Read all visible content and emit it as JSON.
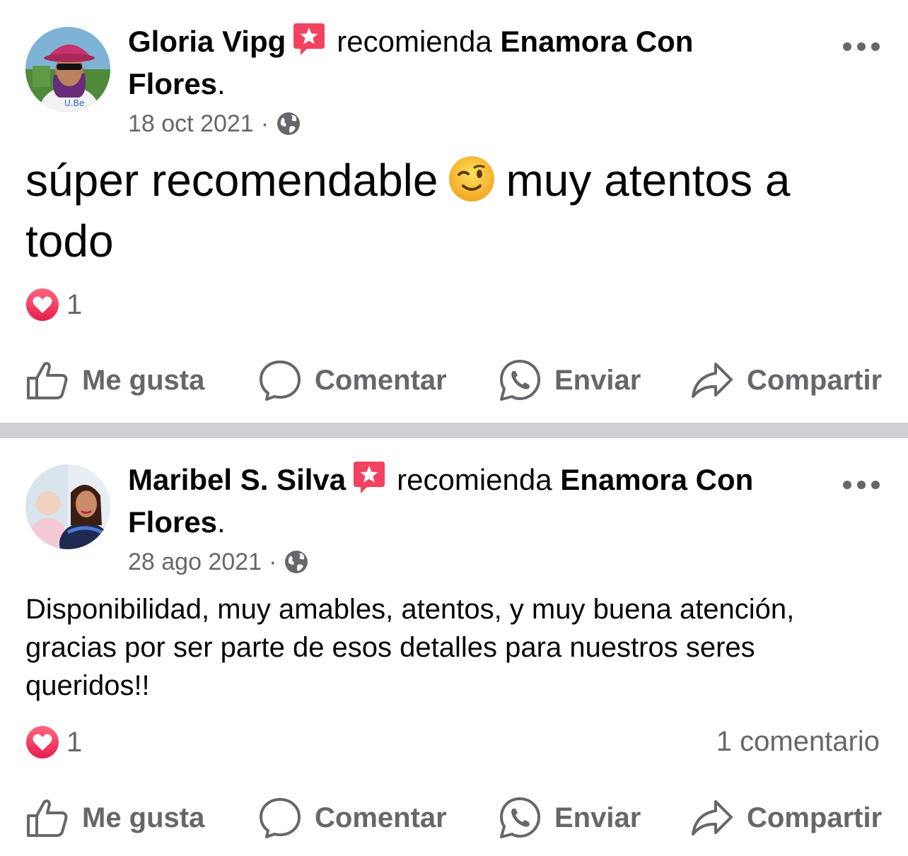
{
  "posts": [
    {
      "author": "Gloria Vipg",
      "verb": "recomienda",
      "page_line1": "Enamora Con",
      "page_line2": "Flores",
      "period": ".",
      "date": "18 oct 2021",
      "separator": "·",
      "text_part1": "súper recomendable",
      "text_part2": "muy atentos a todo",
      "reaction_count": "1",
      "comment_count": ""
    },
    {
      "author": "Maribel S. Silva",
      "verb": "recomienda",
      "page_line1": "Enamora Con",
      "page_line2": "Flores",
      "period": ".",
      "date": "28 ago 2021",
      "separator": "·",
      "text": "Disponibilidad, muy amables, atentos, y muy buena atención, gracias por ser parte de esos detalles  para nuestros seres queridos!!",
      "reaction_count": "1",
      "comment_count": "1 comentario"
    }
  ],
  "actions": {
    "like": "Me gusta",
    "comment": "Comentar",
    "send": "Enviar",
    "share": "Compartir"
  },
  "colors": {
    "secondary_text": "#65676b",
    "separator": "#ced0d4",
    "recommend_badge": "#f3425f",
    "heart": "#f33e58"
  },
  "icons": {
    "badge": "recommend-star-icon",
    "privacy": "globe-icon",
    "reaction": "love-reaction-icon",
    "like": "thumbs-up-icon",
    "comment": "comment-bubble-icon",
    "send": "whatsapp-icon",
    "share": "share-arrow-icon",
    "emoji": "winking-face-icon"
  }
}
